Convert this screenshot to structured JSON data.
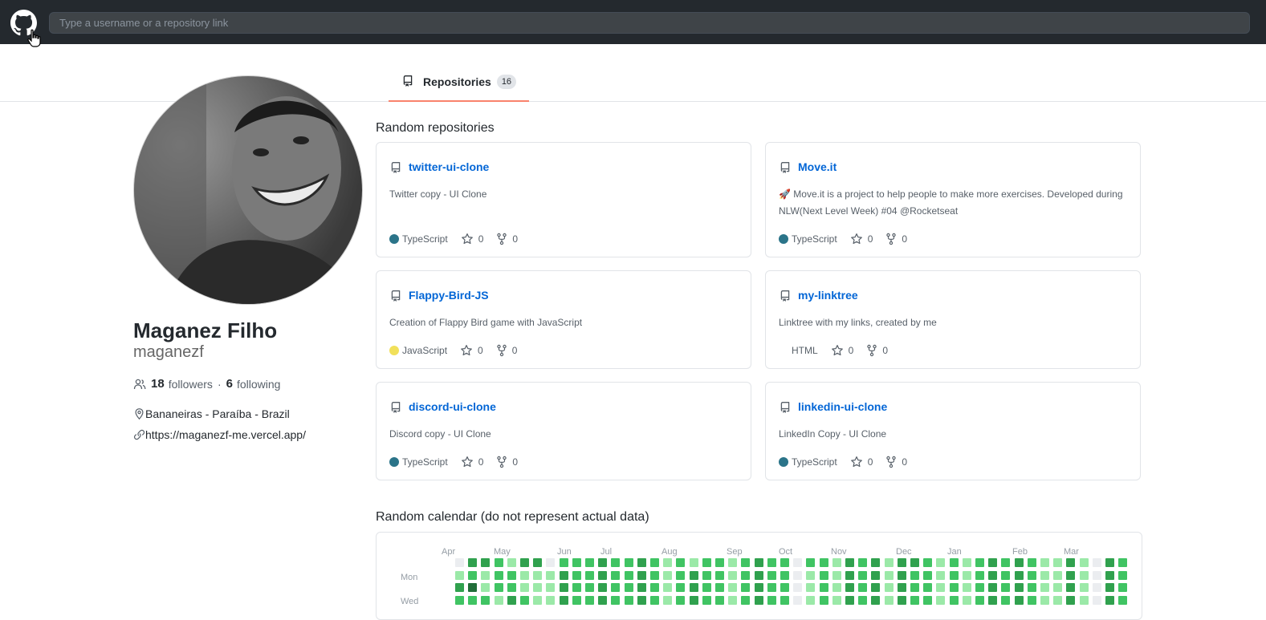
{
  "header": {
    "search_placeholder": "Type a username or a repository link"
  },
  "tabs": {
    "repositories_label": "Repositories",
    "repositories_count": "16"
  },
  "profile": {
    "name": "Maganez Filho",
    "login": "maganezf",
    "followers_count": "18",
    "followers_label": "followers",
    "separator": "·",
    "following_count": "6",
    "following_label": "following",
    "location": "Bananeiras - Paraíba - Brazil",
    "website": "https://maganezf-me.vercel.app/"
  },
  "repos_section_title": "Random repositories",
  "repos": [
    {
      "name": "twitter-ui-clone",
      "description": "Twitter copy - UI Clone",
      "language": "TypeScript",
      "lang_color": "#2b7489",
      "stars": "0",
      "forks": "0"
    },
    {
      "name": "Move.it",
      "description": "🚀 Move.it is a project to help people to make more exercises. Developed during NLW(Next Level Week) #04 @Rocketseat",
      "language": "TypeScript",
      "lang_color": "#2b7489",
      "stars": "0",
      "forks": "0"
    },
    {
      "name": "Flappy-Bird-JS",
      "description": "Creation of Flappy Bird game with JavaScript",
      "language": "JavaScript",
      "lang_color": "#f1e05a",
      "stars": "0",
      "forks": "0"
    },
    {
      "name": "my-linktree",
      "description": "Linktree with my links, created by me",
      "language": "HTML",
      "lang_color": "",
      "stars": "0",
      "forks": "0"
    },
    {
      "name": "discord-ui-clone",
      "description": "Discord copy - UI Clone",
      "language": "TypeScript",
      "lang_color": "#2b7489",
      "stars": "0",
      "forks": "0"
    },
    {
      "name": "linkedin-ui-clone",
      "description": "LinkedIn Copy - UI Clone",
      "language": "TypeScript",
      "lang_color": "#2b7489",
      "stars": "0",
      "forks": "0"
    }
  ],
  "calendar": {
    "title": "Random calendar (do not represent actual data)",
    "months": [
      "Apr",
      "May",
      "Jun",
      "Jul",
      "Aug",
      "Sep",
      "Oct",
      "Nov",
      "Dec",
      "Jan",
      "Feb",
      "Mar"
    ],
    "days": [
      "Mon",
      "Wed"
    ],
    "colors": [
      "#ebedf0",
      "#9be9a8",
      "#40c463",
      "#30a14e",
      "#216e39"
    ],
    "rows": [
      "0332133022232232121221232202213231332121232321131032203434112221212240223434012222",
      "1212211132232232123221232201213231322121232321131032201221012221212232223434012222",
      "3412211132232232123221232201213231322121232321131032201221012221212232223434012222",
      "2221321132232232123221232201213231322121232321131032201221012221212232223434012222"
    ]
  }
}
